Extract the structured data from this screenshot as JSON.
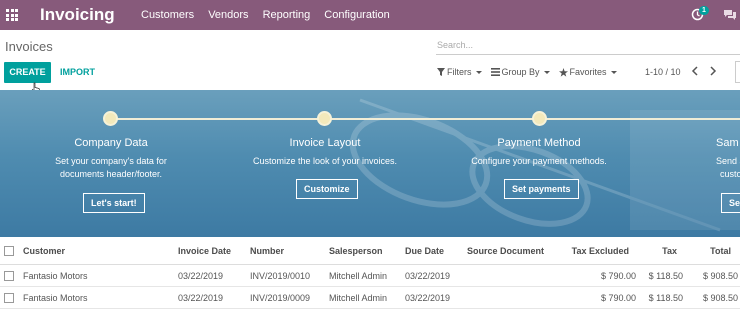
{
  "navbar": {
    "app_title": "Invoicing",
    "menu": [
      "Customers",
      "Vendors",
      "Reporting",
      "Configuration"
    ],
    "activity_count": "1",
    "bg_color": "#875a7b"
  },
  "control": {
    "page_title": "Invoices",
    "search_placeholder": "Search...",
    "create_label": "CREATE",
    "import_label": "IMPORT",
    "filters_label": "Filters",
    "groupby_label": "Group By",
    "favorites_label": "Favorites",
    "pager": "1-10 / 10",
    "accent_color": "#00a09d"
  },
  "onboarding": {
    "steps": [
      {
        "title": "Company Data",
        "desc1": "Set your company's data for",
        "desc2": "documents header/footer.",
        "button": "Let's start!"
      },
      {
        "title": "Invoice Layout",
        "desc1": "Customize the look of your invoices.",
        "desc2": "",
        "button": "Customize"
      },
      {
        "title": "Payment Method",
        "desc1": "Configure your payment methods.",
        "desc2": "",
        "button": "Set payments"
      },
      {
        "title": "Sam",
        "desc1": "Send an i",
        "desc2": "custo",
        "button": "Se"
      }
    ]
  },
  "table": {
    "columns": [
      "Customer",
      "Invoice Date",
      "Number",
      "Salesperson",
      "Due Date",
      "Source Document",
      "Tax Excluded",
      "Tax",
      "Total"
    ],
    "rows": [
      {
        "customer": "Fantasio Motors",
        "invoice_date": "03/22/2019",
        "number": "INV/2019/0010",
        "salesperson": "Mitchell Admin",
        "due_date": "03/22/2019",
        "source": "",
        "tax_excluded": "$ 790.00",
        "tax": "$ 118.50",
        "total": "$ 908.50"
      },
      {
        "customer": "Fantasio Motors",
        "invoice_date": "03/22/2019",
        "number": "INV/2019/0009",
        "salesperson": "Mitchell Admin",
        "due_date": "03/22/2019",
        "source": "",
        "tax_excluded": "$ 790.00",
        "tax": "$ 118.50",
        "total": "$ 908.50"
      }
    ]
  }
}
